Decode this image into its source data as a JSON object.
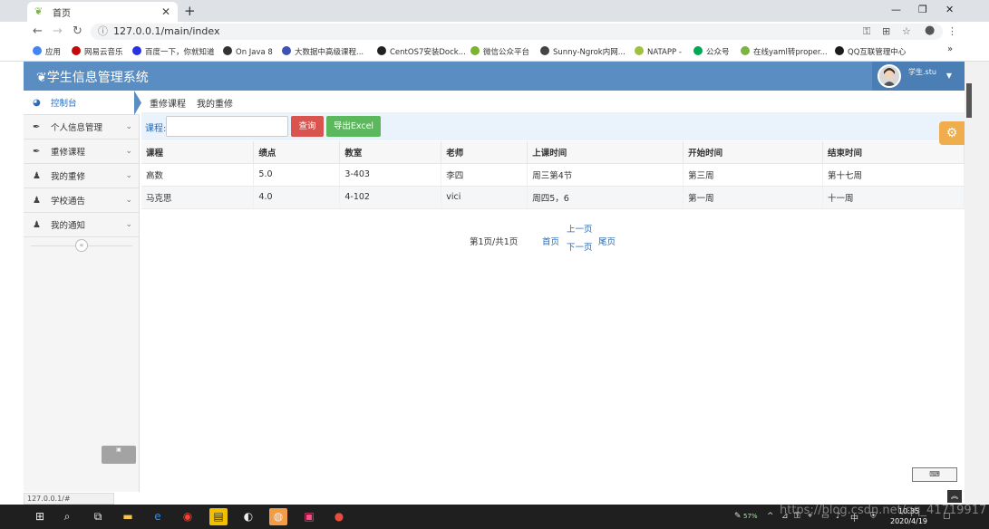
{
  "browser": {
    "tab_title": "首页",
    "url": "127.0.0.1/main/index",
    "bookmarks": [
      "应用",
      "网易云音乐",
      "百度一下，你就知道",
      "On Java 8",
      "大数据中高级课程...",
      "CentOS7安装Dock...",
      "微信公众平台",
      "Sunny-Ngrok内网...",
      "NATAPP -",
      "公众号",
      "在线yaml转proper...",
      "QQ互联管理中心"
    ],
    "bookmark_colors": [
      "#4285f4",
      "#c20c0c",
      "#2932e1",
      "#333333",
      "#3f51b5",
      "#222222",
      "#7bb32e",
      "#444444",
      "#a0c040",
      "#00a854",
      "#7cb342",
      "#1c1c1c"
    ],
    "more": "»",
    "status_url": "127.0.0.1/#"
  },
  "app": {
    "title": "学生信息管理系统",
    "username": "学生.stu"
  },
  "sidebar": {
    "items": [
      {
        "label": "控制台",
        "icon": "dashboard-icon",
        "active": true
      },
      {
        "label": "个人信息管理",
        "icon": "pen-icon"
      },
      {
        "label": "重修课程",
        "icon": "pen-icon"
      },
      {
        "label": "我的重修",
        "icon": "user-icon"
      },
      {
        "label": "学校通告",
        "icon": "user-icon"
      },
      {
        "label": "我的通知",
        "icon": "user-icon"
      }
    ],
    "collapse": "«"
  },
  "breadcrumb": [
    "重修课程",
    "我的重修"
  ],
  "search": {
    "label": "课程:",
    "value": "",
    "query_button": "查询",
    "export_button": "导出Excel"
  },
  "table": {
    "headers": [
      "课程",
      "绩点",
      "教室",
      "老师",
      "上课时间",
      "开始时间",
      "结束时间"
    ],
    "rows": [
      [
        "高数",
        "5.0",
        "3-403",
        "李四",
        "周三第4节",
        "第三周",
        "第十七周"
      ],
      [
        "马克思",
        "4.0",
        "4-102",
        "vici",
        "周四5，6",
        "第一周",
        "十一周"
      ]
    ]
  },
  "pager": {
    "info": "第1页/共1页",
    "first": "首页",
    "prev": "上一页",
    "next": "下一页",
    "last": "尾页"
  },
  "overlay": {
    "watermark": "https://blog.csdn.net/qq_41719917",
    "clock_time": "10:35",
    "clock_date": "2020/4/19",
    "battery": "57%"
  },
  "colors": {
    "header_bg": "#5a8ec2",
    "link": "#2b6cb5",
    "query_btn": "#d9534f",
    "export_btn": "#5cb85c",
    "gear_btn": "#f0ad4e"
  }
}
